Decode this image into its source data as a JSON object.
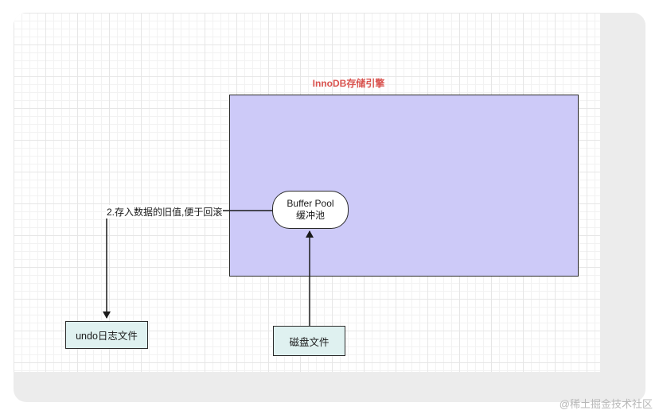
{
  "diagram": {
    "engine": {
      "title": "InnoDB存储引擎",
      "fill": "#cdcaf8",
      "title_color": "#d9534f"
    },
    "buffer_pool": {
      "line1": "Buffer Pool",
      "line2": "缓冲池"
    },
    "undo_log": {
      "label": "undo日志文件",
      "fill": "#dff1f0"
    },
    "disk_file": {
      "label": "磁盘文件",
      "fill": "#dff1f0"
    },
    "edges": [
      {
        "from": "buffer_pool",
        "to": "undo_log",
        "label": "2.存入数据的旧值,便于回滚"
      },
      {
        "from": "disk_file",
        "to": "buffer_pool",
        "label": ""
      }
    ]
  },
  "watermark": "@稀土掘金技术社区"
}
